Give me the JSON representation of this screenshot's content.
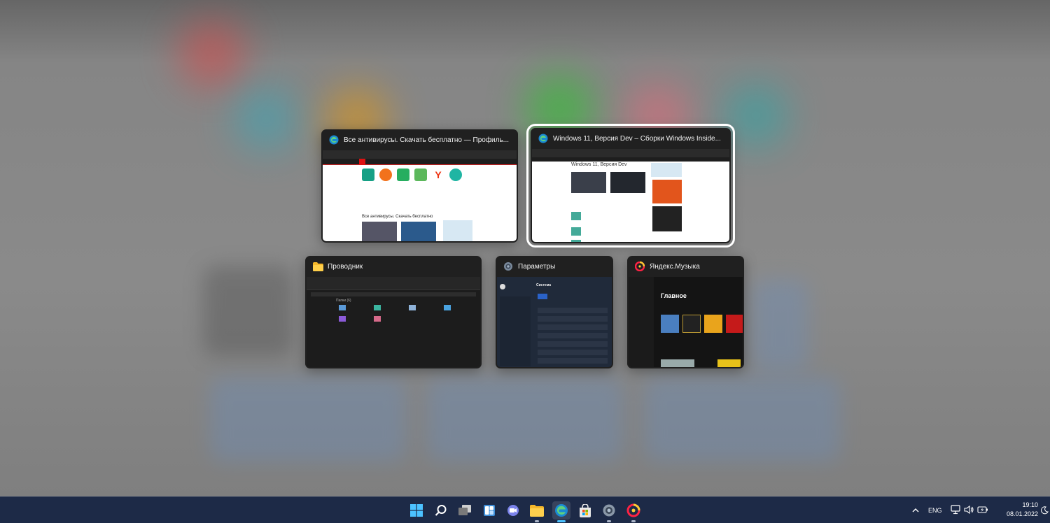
{
  "windows": [
    {
      "title": "Все антивирусы. Скачать бесплатно — Профиль...",
      "app": "edge",
      "selected": false,
      "preview": {
        "heading": "Все антивирусы. Скачать бесплатно"
      }
    },
    {
      "title": "Windows 11, Версия Dev – Сборки Windows Inside...",
      "app": "edge",
      "selected": true,
      "preview": {
        "heading": "Windows 11, Версия Dev"
      }
    },
    {
      "title": "Проводник",
      "app": "file-explorer",
      "selected": false,
      "preview": {
        "heading": "Папки (6)"
      }
    },
    {
      "title": "Параметры",
      "app": "settings",
      "selected": false,
      "preview": {
        "heading": "Система"
      }
    },
    {
      "title": "Яндекс.Музыка",
      "app": "yandex-music",
      "selected": false,
      "preview": {
        "heading": "Главное"
      }
    }
  ],
  "taskbar": {
    "apps": [
      {
        "name": "windows-start-icon",
        "running": false
      },
      {
        "name": "search-icon",
        "running": false
      },
      {
        "name": "task-view-icon",
        "running": false
      },
      {
        "name": "widgets-icon",
        "running": false
      },
      {
        "name": "teams-chat-icon",
        "running": false
      },
      {
        "name": "file-explorer-icon",
        "running": true
      },
      {
        "name": "edge-icon",
        "running": true
      },
      {
        "name": "microsoft-store-icon",
        "running": false
      },
      {
        "name": "settings-icon",
        "running": true
      },
      {
        "name": "yandex-music-icon",
        "running": true
      }
    ],
    "tray": {
      "language": "ENG",
      "time": "19:10",
      "date": "08.01.2022"
    }
  },
  "colors": {
    "taskbar": "#1d2a47",
    "accent": "#0078d4",
    "selected_outline": "#ffffff"
  }
}
